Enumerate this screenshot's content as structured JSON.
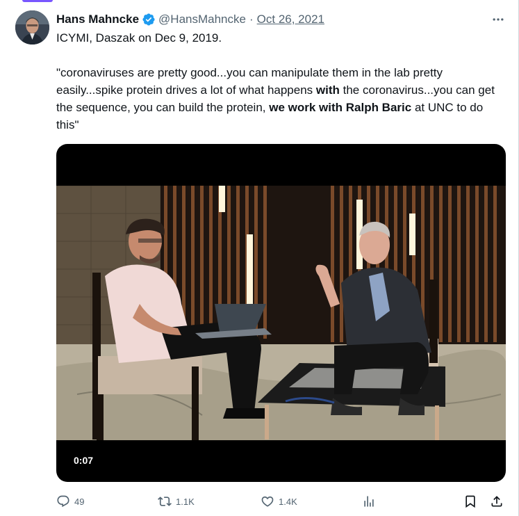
{
  "colors": {
    "accent": "#7856ff",
    "verified_blue": "#1d9bf0",
    "muted_text": "#536471",
    "body_text": "#0f1419"
  },
  "author": {
    "name": "Hans Mahncke",
    "handle": "@HansMahncke",
    "separator": "·",
    "date": "Oct 26, 2021",
    "verified_icon": "verified-badge-icon",
    "avatar_icon": "avatar"
  },
  "tweet": {
    "line1": "ICYMI, Daszak on Dec 9, 2019.",
    "quote_part1": "\"coronaviruses are pretty good...you can manipulate them in the lab pretty easily...spike protein drives a lot of what happens ",
    "quote_bold1": "with",
    "quote_part2": " the coronavirus...you can get the sequence, you can build the protein, ",
    "quote_bold2": "we work with Ralph Baric",
    "quote_part3": " at UNC to do this\""
  },
  "video": {
    "timestamp": "0:07"
  },
  "actions": {
    "replies": "49",
    "reposts": "1.1K",
    "likes": "1.4K",
    "views_icon": "analytics-icon",
    "bookmark_icon": "bookmark-icon",
    "share_icon": "share-icon"
  },
  "more_icon": "more-options-icon"
}
